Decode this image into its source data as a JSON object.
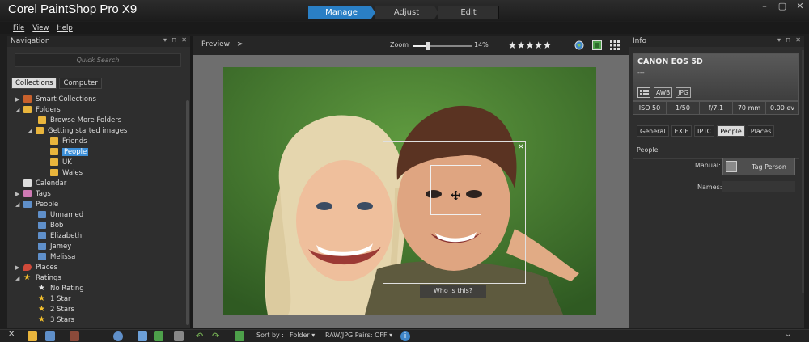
{
  "app": {
    "title": "Corel PaintShop Pro X9",
    "workspace_tabs": [
      "Manage",
      "Adjust",
      "Edit"
    ],
    "active_tab": "Manage"
  },
  "menu": [
    "File",
    "View",
    "Help"
  ],
  "navigation": {
    "title": "Navigation",
    "search_placeholder": "Quick Search",
    "tabs": [
      "Collections",
      "Computer"
    ],
    "active_tab": "Collections",
    "tree": [
      {
        "label": "Smart Collections",
        "icon": "smart-collections-icon"
      },
      {
        "label": "Folders",
        "icon": "folder-icon"
      },
      {
        "label": "Browse More Folders",
        "icon": "folder-add-icon"
      },
      {
        "label": "Getting started images",
        "icon": "folder-icon"
      },
      {
        "label": "Friends",
        "icon": "folder-icon"
      },
      {
        "label": "People",
        "icon": "folder-icon",
        "selected": true
      },
      {
        "label": "UK",
        "icon": "folder-icon"
      },
      {
        "label": "Wales",
        "icon": "folder-icon"
      },
      {
        "label": "Calendar",
        "icon": "calendar-icon"
      },
      {
        "label": "Tags",
        "icon": "tag-icon"
      },
      {
        "label": "People",
        "icon": "person-icon"
      },
      {
        "label": "Unnamed",
        "icon": "person-icon"
      },
      {
        "label": "Bob",
        "icon": "person-icon"
      },
      {
        "label": "Elizabeth",
        "icon": "person-icon"
      },
      {
        "label": "Jamey",
        "icon": "person-icon"
      },
      {
        "label": "Melissa",
        "icon": "person-icon"
      },
      {
        "label": "Places",
        "icon": "map-pin-icon"
      },
      {
        "label": "Ratings",
        "icon": "star-icon"
      },
      {
        "label": "No Rating",
        "icon": "star-outline-icon"
      },
      {
        "label": "1 Star",
        "icon": "star-icon"
      },
      {
        "label": "2 Stars",
        "icon": "star-icon"
      },
      {
        "label": "3 Stars",
        "icon": "star-icon"
      }
    ]
  },
  "preview": {
    "label": "Preview",
    "arrow": ">",
    "zoom_label": "Zoom",
    "zoom_value": "14%",
    "zoom_fraction": 0.25,
    "rating_stars": "★★★★★",
    "close_glyph": "×",
    "face_prompt": "Who is this?"
  },
  "info": {
    "title": "Info",
    "camera": "CANON EOS 5D",
    "camera_sub": "---",
    "badges": [
      "AWB",
      "JPG"
    ],
    "exif": [
      "ISO 50",
      "1/50",
      "f/7.1",
      "70 mm",
      "0.00 ev"
    ],
    "tabs": [
      "General",
      "EXIF",
      "IPTC",
      "People",
      "Places"
    ],
    "active_tab": "People",
    "people_heading": "People",
    "manual_label": "Manual:",
    "tag_person": "Tag Person",
    "names_label": "Names:"
  },
  "bottom": {
    "sort_label": "Sort by :",
    "sort_value": "Folder",
    "raw_label": "RAW/JPG Pairs: OFF"
  },
  "colors": {
    "accent": "#2a7fc5",
    "selection": "#3c8fd8",
    "folder": "#e9b53c"
  }
}
